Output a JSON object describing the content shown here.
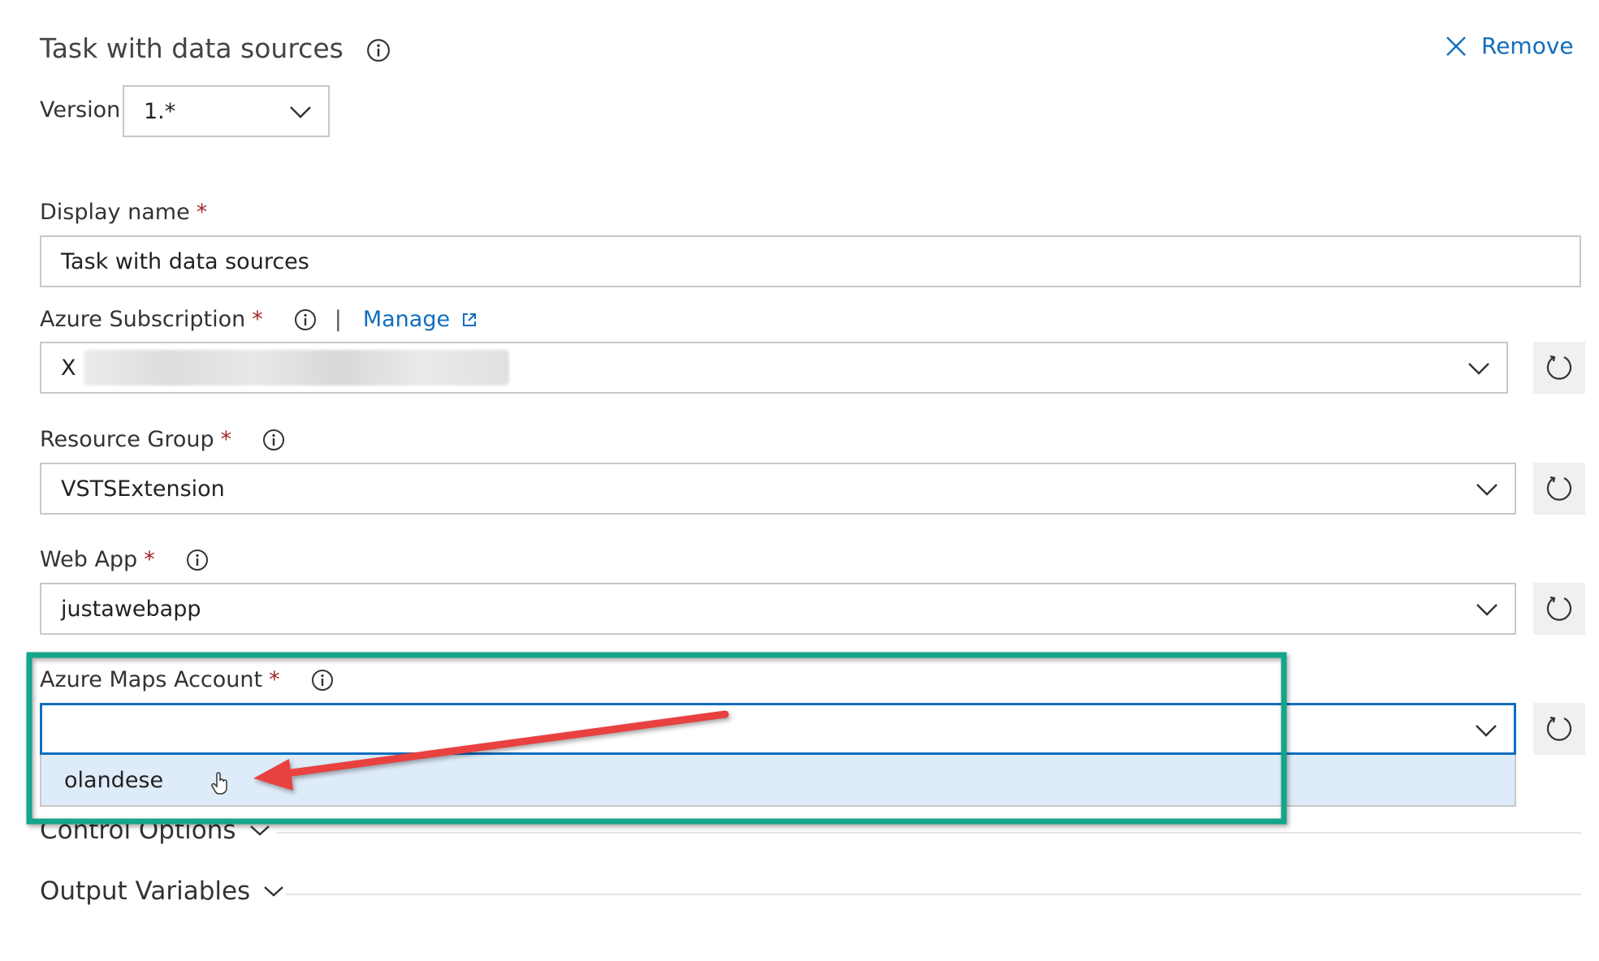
{
  "task": {
    "title": "Task with data sources",
    "remove_label": "Remove",
    "version_label": "Version",
    "version_value": "1.*"
  },
  "fields": {
    "display_name": {
      "label": "Display name",
      "value": "Task with data sources"
    },
    "azure_subscription": {
      "label": "Azure Subscription",
      "manage_label": "Manage",
      "value_prefix": "X"
    },
    "resource_group": {
      "label": "Resource Group",
      "value": "VSTSExtension"
    },
    "web_app": {
      "label": "Web App",
      "value": "justawebapp"
    },
    "azure_maps_account": {
      "label": "Azure Maps Account",
      "value": "",
      "options": [
        "olandese"
      ]
    }
  },
  "required_marker": "*",
  "separator": "|",
  "sections": {
    "control_options": "Control Options",
    "output_variables": "Output Variables"
  },
  "colors": {
    "accent": "#106ebe",
    "highlight_box": "#15a589",
    "annotation_arrow": "#e8413f",
    "option_hover": "#deecf9"
  }
}
